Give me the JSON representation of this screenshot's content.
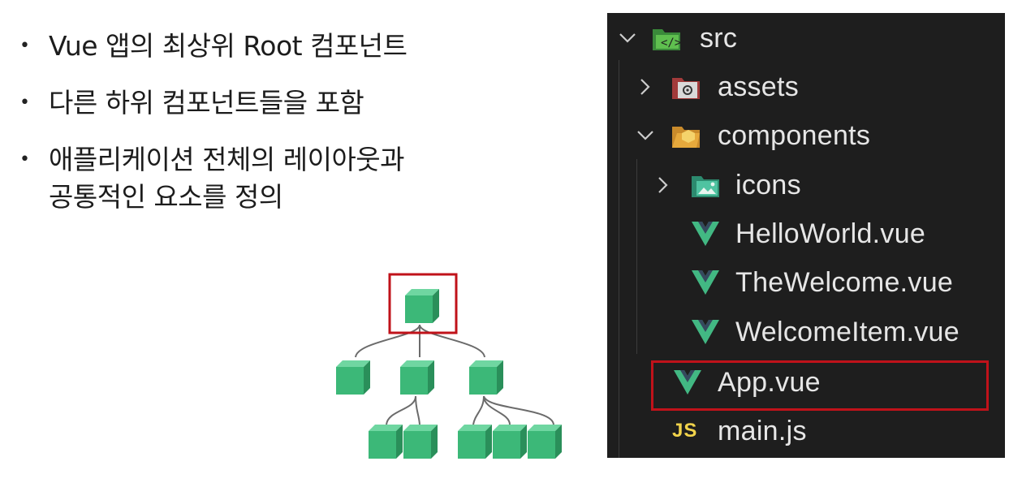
{
  "bullets": [
    {
      "lines": [
        "Vue 앱의 최상위 Root 컴포넌트"
      ]
    },
    {
      "lines": [
        "다른 하위 컴포넌트들을 포함"
      ]
    },
    {
      "lines": [
        "애플리케이션 전체의 레이아웃과",
        "공통적인 요소를 정의"
      ]
    }
  ],
  "explorer": {
    "root": {
      "label": "src",
      "expanded": true,
      "icon": "src-folder-icon"
    },
    "assets": {
      "label": "assets",
      "expanded": false,
      "icon": "assets-folder-icon"
    },
    "components": {
      "label": "components",
      "expanded": true,
      "icon": "components-folder-icon"
    },
    "icons": {
      "label": "icons",
      "expanded": false,
      "icon": "icons-folder-icon"
    },
    "files": {
      "helloworld": "HelloWorld.vue",
      "thewelcome": "TheWelcome.vue",
      "welcomeitem": "WelcomeItem.vue",
      "app": "App.vue",
      "main": "main.js",
      "js_badge": "JS"
    },
    "highlighted": "App.vue"
  },
  "colors": {
    "highlight": "#c0121a",
    "vue_green": "#42b883",
    "vue_dark": "#35495e",
    "cube": "#3cb878",
    "explorer_bg": "#1e1e1e",
    "js_yellow": "#f1d34b"
  }
}
